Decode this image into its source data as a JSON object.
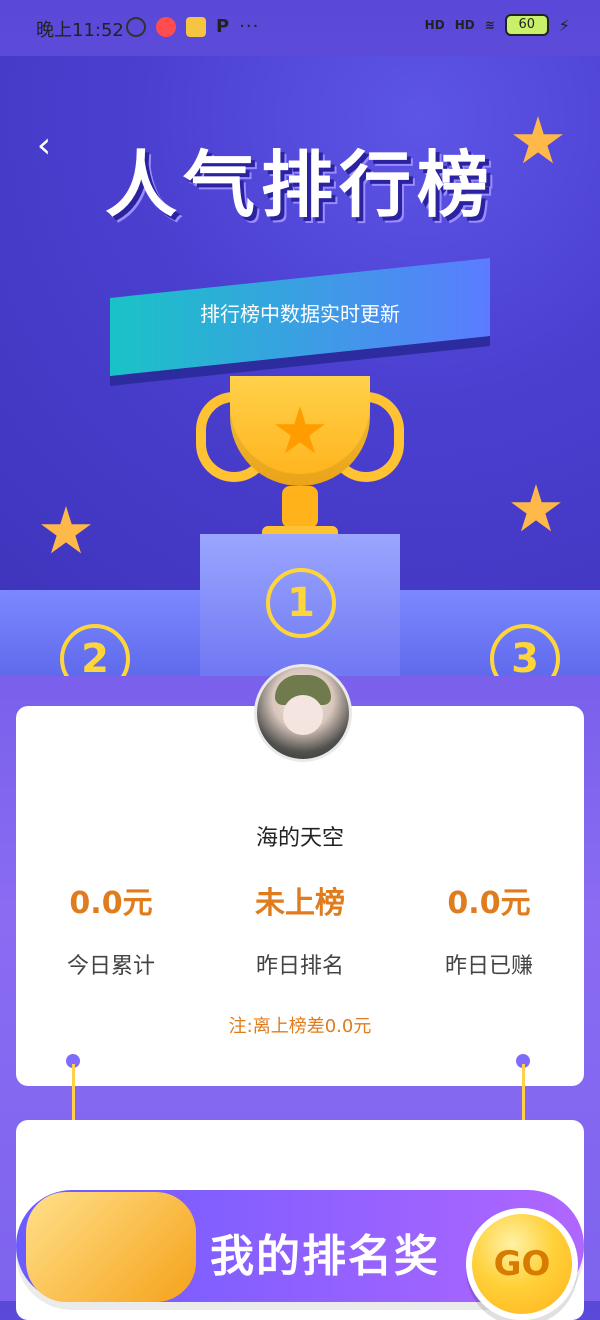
{
  "status_bar": {
    "time": "晚上11:52",
    "left_icons": [
      "alarm-icon",
      "weibo-icon",
      "cashapp-icon",
      "p-icon"
    ],
    "more": "···",
    "signal_1": "HD",
    "signal_2": "HD",
    "battery": "60"
  },
  "hero": {
    "title": "人气排行榜",
    "subtitle": "排行榜中数据实时更新",
    "podium_numbers": [
      "1",
      "2",
      "3"
    ]
  },
  "profile": {
    "username": "海的天空",
    "stats": [
      {
        "value": "0.0元",
        "label": "今日累计"
      },
      {
        "value": "未上榜",
        "label": "昨日排名"
      },
      {
        "value": "0.0元",
        "label": "昨日已赚"
      }
    ],
    "note": "注:离上榜差0.0元"
  },
  "banner": {
    "text": "我的排名奖",
    "go": "GO"
  }
}
